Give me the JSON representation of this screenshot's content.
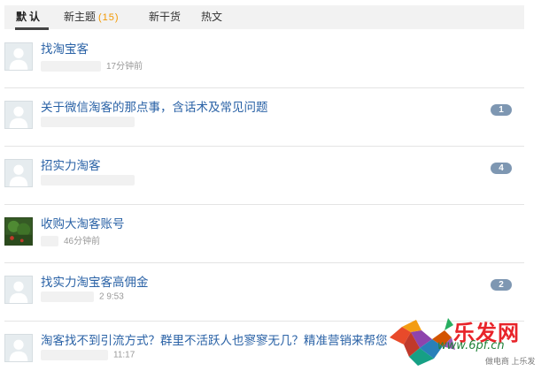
{
  "tabs": [
    {
      "label": "默认",
      "active": true
    },
    {
      "label": "新主题",
      "count": "(15)"
    },
    {
      "label": "新干货"
    },
    {
      "label": "热文"
    }
  ],
  "threads": [
    {
      "title": "找淘宝客",
      "time": "17分钟前",
      "replies": null,
      "avatar": "default-avatar"
    },
    {
      "title": "关于微信淘客的那点事，含话术及常见问题",
      "time": "",
      "replies": "1",
      "avatar": "default-avatar"
    },
    {
      "title": "招实力淘客",
      "time": "",
      "replies": "4",
      "avatar": "default-avatar"
    },
    {
      "title": "收购大淘客账号",
      "time": "46分钟前",
      "replies": null,
      "avatar": "photo-avatar"
    },
    {
      "title": "找实力淘宝客高佣金",
      "time": "2  9:53",
      "replies": "2",
      "avatar": "default-avatar"
    },
    {
      "title": "淘客找不到引流方式？群里不活跃人也寥寥无几？精准营销来帮您",
      "time": "11:17",
      "replies": null,
      "avatar": "default-avatar"
    }
  ],
  "watermark": {
    "brand": "乐发网",
    "url": "www.6pf.cn",
    "sub": "做电商 上乐发"
  },
  "colors": {
    "link": "#2a62a6",
    "badge": "#7e97b2",
    "count": "#f39800",
    "brand": "#e8242a"
  }
}
